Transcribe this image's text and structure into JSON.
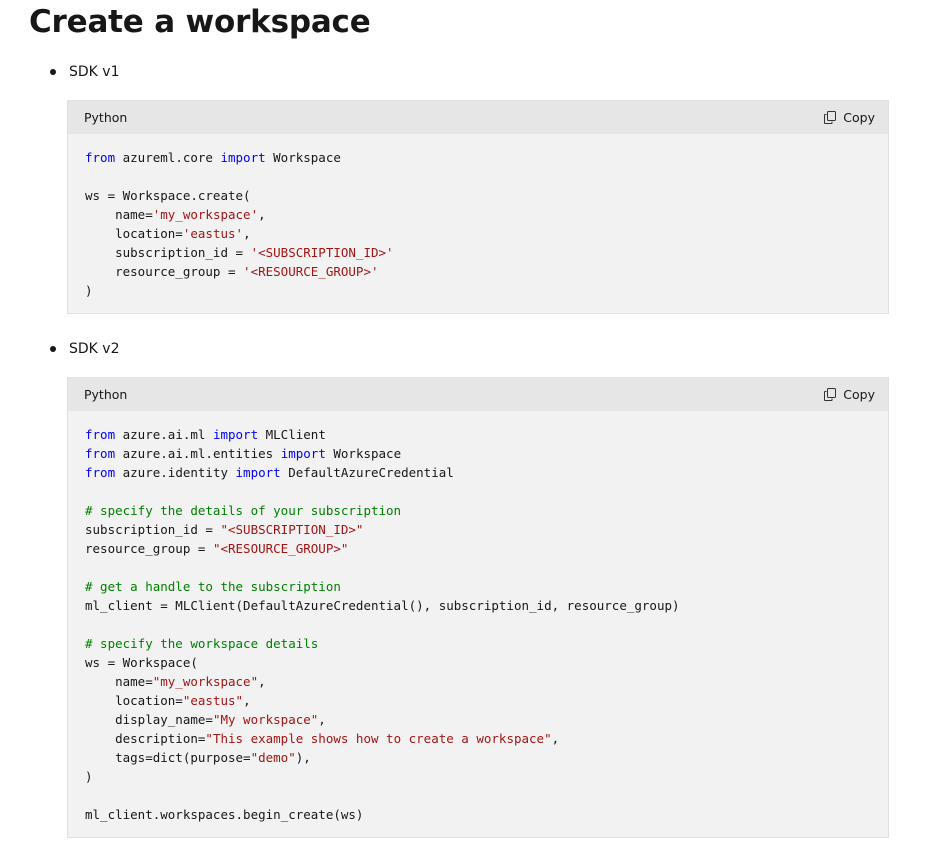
{
  "page": {
    "title": "Create a workspace"
  },
  "sections": [
    {
      "bullet": "SDK v1",
      "language": "Python",
      "copy_label": "Copy",
      "code_lines": [
        [
          {
            "t": "kw",
            "v": "from"
          },
          {
            "t": "p",
            "v": " azureml.core "
          },
          {
            "t": "kw",
            "v": "import"
          },
          {
            "t": "p",
            "v": " Workspace"
          }
        ],
        [],
        [
          {
            "t": "p",
            "v": "ws = Workspace.create("
          }
        ],
        [
          {
            "t": "p",
            "v": "    name="
          },
          {
            "t": "str",
            "v": "'my_workspace'"
          },
          {
            "t": "p",
            "v": ","
          }
        ],
        [
          {
            "t": "p",
            "v": "    location="
          },
          {
            "t": "str",
            "v": "'eastus'"
          },
          {
            "t": "p",
            "v": ","
          }
        ],
        [
          {
            "t": "p",
            "v": "    subscription_id = "
          },
          {
            "t": "str",
            "v": "'<SUBSCRIPTION_ID>'"
          }
        ],
        [
          {
            "t": "p",
            "v": "    resource_group = "
          },
          {
            "t": "str",
            "v": "'<RESOURCE_GROUP>'"
          }
        ],
        [
          {
            "t": "p",
            "v": ")"
          }
        ]
      ]
    },
    {
      "bullet": "SDK v2",
      "language": "Python",
      "copy_label": "Copy",
      "code_lines": [
        [
          {
            "t": "kw",
            "v": "from"
          },
          {
            "t": "p",
            "v": " azure.ai.ml "
          },
          {
            "t": "kw",
            "v": "import"
          },
          {
            "t": "p",
            "v": " MLClient"
          }
        ],
        [
          {
            "t": "kw",
            "v": "from"
          },
          {
            "t": "p",
            "v": " azure.ai.ml.entities "
          },
          {
            "t": "kw",
            "v": "import"
          },
          {
            "t": "p",
            "v": " Workspace"
          }
        ],
        [
          {
            "t": "kw",
            "v": "from"
          },
          {
            "t": "p",
            "v": " azure.identity "
          },
          {
            "t": "kw",
            "v": "import"
          },
          {
            "t": "p",
            "v": " DefaultAzureCredential"
          }
        ],
        [],
        [
          {
            "t": "cm",
            "v": "# specify the details of your subscription"
          }
        ],
        [
          {
            "t": "p",
            "v": "subscription_id = "
          },
          {
            "t": "str",
            "v": "\"<SUBSCRIPTION_ID>\""
          }
        ],
        [
          {
            "t": "p",
            "v": "resource_group = "
          },
          {
            "t": "str",
            "v": "\"<RESOURCE_GROUP>\""
          }
        ],
        [],
        [
          {
            "t": "cm",
            "v": "# get a handle to the subscription"
          }
        ],
        [
          {
            "t": "p",
            "v": "ml_client = MLClient(DefaultAzureCredential(), subscription_id, resource_group)"
          }
        ],
        [],
        [
          {
            "t": "cm",
            "v": "# specify the workspace details"
          }
        ],
        [
          {
            "t": "p",
            "v": "ws = Workspace("
          }
        ],
        [
          {
            "t": "p",
            "v": "    name="
          },
          {
            "t": "str",
            "v": "\"my_workspace\""
          },
          {
            "t": "p",
            "v": ","
          }
        ],
        [
          {
            "t": "p",
            "v": "    location="
          },
          {
            "t": "str",
            "v": "\"eastus\""
          },
          {
            "t": "p",
            "v": ","
          }
        ],
        [
          {
            "t": "p",
            "v": "    display_name="
          },
          {
            "t": "str",
            "v": "\"My workspace\""
          },
          {
            "t": "p",
            "v": ","
          }
        ],
        [
          {
            "t": "p",
            "v": "    description="
          },
          {
            "t": "str",
            "v": "\"This example shows how to create a workspace\""
          },
          {
            "t": "p",
            "v": ","
          }
        ],
        [
          {
            "t": "p",
            "v": "    tags=dict(purpose="
          },
          {
            "t": "str",
            "v": "\"demo\""
          },
          {
            "t": "p",
            "v": "),"
          }
        ],
        [
          {
            "t": "p",
            "v": ")"
          }
        ],
        [],
        [
          {
            "t": "p",
            "v": "ml_client.workspaces.begin_create(ws)"
          }
        ]
      ]
    }
  ],
  "icons": {
    "copy": "copy-icon"
  },
  "colors": {
    "keyword": "#0101fd",
    "string": "#a31515",
    "comment": "#008000",
    "code_background": "#f2f2f2",
    "code_header_background": "#e6e6e6"
  }
}
